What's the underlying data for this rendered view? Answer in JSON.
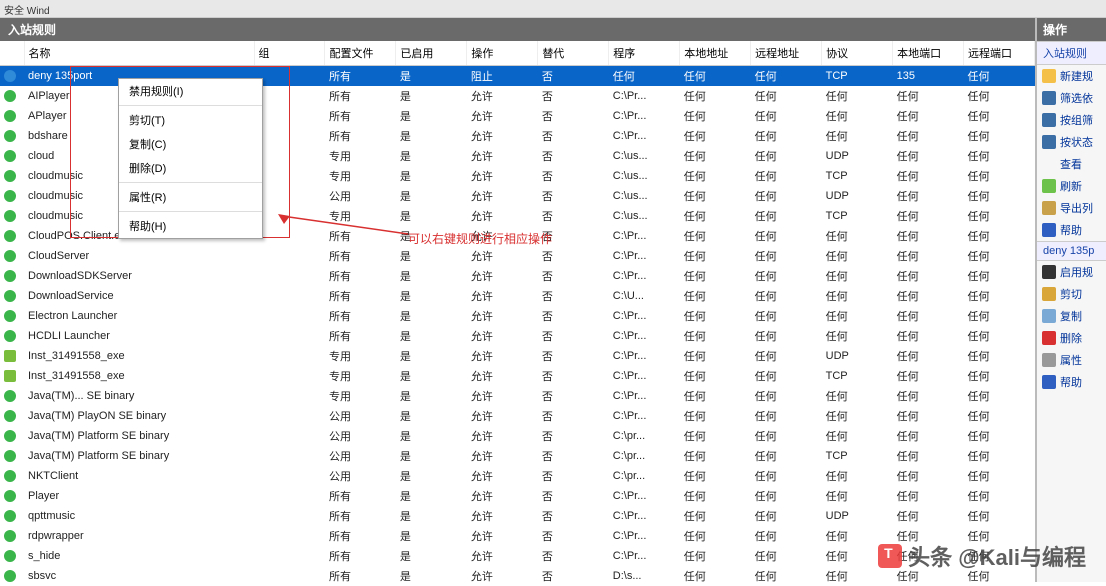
{
  "toolbar": {
    "title": "安全 Wind"
  },
  "section_title": "入站规则",
  "columns": [
    "名称",
    "组",
    "配置文件",
    "已启用",
    "操作",
    "替代",
    "程序",
    "本地地址",
    "远程地址",
    "协议",
    "本地端口",
    "远程端口"
  ],
  "context_menu": {
    "items": [
      "禁用规则(I)",
      "剪切(T)",
      "复制(C)",
      "删除(D)",
      "属性(R)",
      "帮助(H)"
    ]
  },
  "annotation": "可以右键规则进行相应操作",
  "watermark": "头条 @Kali与编程",
  "rows": [
    {
      "ic": "ic-blue",
      "name": "deny 135port",
      "grp": "",
      "prof": "所有",
      "en": "是",
      "act": "阻止",
      "repl": "否",
      "prog": "任何",
      "la": "任何",
      "ra": "任何",
      "proto": "TCP",
      "lp": "135",
      "rp": "任何",
      "sel": true
    },
    {
      "ic": "ic-green",
      "name": "AIPlayer",
      "grp": "",
      "prof": "所有",
      "en": "是",
      "act": "允许",
      "repl": "否",
      "prog": "C:\\Pr...",
      "la": "任何",
      "ra": "任何",
      "proto": "任何",
      "lp": "任何",
      "rp": "任何"
    },
    {
      "ic": "ic-green",
      "name": "APlayer",
      "grp": "",
      "prof": "所有",
      "en": "是",
      "act": "允许",
      "repl": "否",
      "prog": "C:\\Pr...",
      "la": "任何",
      "ra": "任何",
      "proto": "任何",
      "lp": "任何",
      "rp": "任何"
    },
    {
      "ic": "ic-green",
      "name": "bdshare",
      "grp": "",
      "prof": "所有",
      "en": "是",
      "act": "允许",
      "repl": "否",
      "prog": "C:\\Pr...",
      "la": "任何",
      "ra": "任何",
      "proto": "任何",
      "lp": "任何",
      "rp": "任何"
    },
    {
      "ic": "ic-green",
      "name": "cloud",
      "grp": "",
      "prof": "专用",
      "en": "是",
      "act": "允许",
      "repl": "否",
      "prog": "C:\\us...",
      "la": "任何",
      "ra": "任何",
      "proto": "UDP",
      "lp": "任何",
      "rp": "任何"
    },
    {
      "ic": "ic-green",
      "name": "cloudmusic",
      "grp": "",
      "prof": "专用",
      "en": "是",
      "act": "允许",
      "repl": "否",
      "prog": "C:\\us...",
      "la": "任何",
      "ra": "任何",
      "proto": "TCP",
      "lp": "任何",
      "rp": "任何"
    },
    {
      "ic": "ic-green",
      "name": "cloudmusic",
      "grp": "",
      "prof": "公用",
      "en": "是",
      "act": "允许",
      "repl": "否",
      "prog": "C:\\us...",
      "la": "任何",
      "ra": "任何",
      "proto": "UDP",
      "lp": "任何",
      "rp": "任何"
    },
    {
      "ic": "ic-green",
      "name": "cloudmusic",
      "grp": "",
      "prof": "专用",
      "en": "是",
      "act": "允许",
      "repl": "否",
      "prog": "C:\\us...",
      "la": "任何",
      "ra": "任何",
      "proto": "TCP",
      "lp": "任何",
      "rp": "任何"
    },
    {
      "ic": "ic-green",
      "name": "CloudPOS.Client.exe",
      "grp": "",
      "prof": "所有",
      "en": "是",
      "act": "允许",
      "repl": "否",
      "prog": "C:\\Pr...",
      "la": "任何",
      "ra": "任何",
      "proto": "任何",
      "lp": "任何",
      "rp": "任何"
    },
    {
      "ic": "ic-green",
      "name": "CloudServer",
      "grp": "",
      "prof": "所有",
      "en": "是",
      "act": "允许",
      "repl": "否",
      "prog": "C:\\Pr...",
      "la": "任何",
      "ra": "任何",
      "proto": "任何",
      "lp": "任何",
      "rp": "任何"
    },
    {
      "ic": "ic-green",
      "name": "DownloadSDKServer",
      "grp": "",
      "prof": "所有",
      "en": "是",
      "act": "允许",
      "repl": "否",
      "prog": "C:\\Pr...",
      "la": "任何",
      "ra": "任何",
      "proto": "任何",
      "lp": "任何",
      "rp": "任何"
    },
    {
      "ic": "ic-green",
      "name": "DownloadService",
      "grp": "",
      "prof": "所有",
      "en": "是",
      "act": "允许",
      "repl": "否",
      "prog": "C:\\U...",
      "la": "任何",
      "ra": "任何",
      "proto": "任何",
      "lp": "任何",
      "rp": "任何"
    },
    {
      "ic": "ic-green",
      "name": "Electron Launcher",
      "grp": "",
      "prof": "所有",
      "en": "是",
      "act": "允许",
      "repl": "否",
      "prog": "C:\\Pr...",
      "la": "任何",
      "ra": "任何",
      "proto": "任何",
      "lp": "任何",
      "rp": "任何"
    },
    {
      "ic": "ic-green",
      "name": "HCDLI Launcher",
      "grp": "",
      "prof": "所有",
      "en": "是",
      "act": "允许",
      "repl": "否",
      "prog": "C:\\Pr...",
      "la": "任何",
      "ra": "任何",
      "proto": "任何",
      "lp": "任何",
      "rp": "任何"
    },
    {
      "ic": "ic-green2",
      "name": "Inst_31491558_exe",
      "grp": "",
      "prof": "专用",
      "en": "是",
      "act": "允许",
      "repl": "否",
      "prog": "C:\\Pr...",
      "la": "任何",
      "ra": "任何",
      "proto": "UDP",
      "lp": "任何",
      "rp": "任何"
    },
    {
      "ic": "ic-green2",
      "name": "Inst_31491558_exe",
      "grp": "",
      "prof": "专用",
      "en": "是",
      "act": "允许",
      "repl": "否",
      "prog": "C:\\Pr...",
      "la": "任何",
      "ra": "任何",
      "proto": "TCP",
      "lp": "任何",
      "rp": "任何"
    },
    {
      "ic": "ic-green",
      "name": "Java(TM)... SE binary",
      "grp": "",
      "prof": "专用",
      "en": "是",
      "act": "允许",
      "repl": "否",
      "prog": "C:\\Pr...",
      "la": "任何",
      "ra": "任何",
      "proto": "任何",
      "lp": "任何",
      "rp": "任何"
    },
    {
      "ic": "ic-green",
      "name": "Java(TM) PlayON SE binary",
      "grp": "",
      "prof": "公用",
      "en": "是",
      "act": "允许",
      "repl": "否",
      "prog": "C:\\Pr...",
      "la": "任何",
      "ra": "任何",
      "proto": "任何",
      "lp": "任何",
      "rp": "任何"
    },
    {
      "ic": "ic-green",
      "name": "Java(TM) Platform SE binary",
      "grp": "",
      "prof": "公用",
      "en": "是",
      "act": "允许",
      "repl": "否",
      "prog": "C:\\pr...",
      "la": "任何",
      "ra": "任何",
      "proto": "任何",
      "lp": "任何",
      "rp": "任何"
    },
    {
      "ic": "ic-green",
      "name": "Java(TM) Platform SE binary",
      "grp": "",
      "prof": "公用",
      "en": "是",
      "act": "允许",
      "repl": "否",
      "prog": "C:\\pr...",
      "la": "任何",
      "ra": "任何",
      "proto": "TCP",
      "lp": "任何",
      "rp": "任何"
    },
    {
      "ic": "ic-green",
      "name": "NKTClient",
      "grp": "",
      "prof": "公用",
      "en": "是",
      "act": "允许",
      "repl": "否",
      "prog": "C:\\pr...",
      "la": "任何",
      "ra": "任何",
      "proto": "任何",
      "lp": "任何",
      "rp": "任何"
    },
    {
      "ic": "ic-green",
      "name": "Player",
      "grp": "",
      "prof": "所有",
      "en": "是",
      "act": "允许",
      "repl": "否",
      "prog": "C:\\Pr...",
      "la": "任何",
      "ra": "任何",
      "proto": "任何",
      "lp": "任何",
      "rp": "任何"
    },
    {
      "ic": "ic-green",
      "name": "qpttmusic",
      "grp": "",
      "prof": "所有",
      "en": "是",
      "act": "允许",
      "repl": "否",
      "prog": "C:\\Pr...",
      "la": "任何",
      "ra": "任何",
      "proto": "UDP",
      "lp": "任何",
      "rp": "任何"
    },
    {
      "ic": "ic-green",
      "name": "rdpwrapper",
      "grp": "",
      "prof": "所有",
      "en": "是",
      "act": "允许",
      "repl": "否",
      "prog": "C:\\Pr...",
      "la": "任何",
      "ra": "任何",
      "proto": "任何",
      "lp": "任何",
      "rp": "任何"
    },
    {
      "ic": "ic-green",
      "name": "s_hide",
      "grp": "",
      "prof": "所有",
      "en": "是",
      "act": "允许",
      "repl": "否",
      "prog": "C:\\Pr...",
      "la": "任何",
      "ra": "任何",
      "proto": "任何",
      "lp": "任何",
      "rp": "任何"
    },
    {
      "ic": "ic-green",
      "name": "sbsvc",
      "grp": "",
      "prof": "所有",
      "en": "是",
      "act": "允许",
      "repl": "否",
      "prog": "D:\\s...",
      "la": "任何",
      "ra": "任何",
      "proto": "任何",
      "lp": "任何",
      "rp": "任何"
    }
  ],
  "right": {
    "header": "操作",
    "section1": "入站规则",
    "items1": [
      {
        "ic": "#f5c048",
        "t": "新建规"
      },
      {
        "ic": "#3a6ea5",
        "t": "筛选依"
      },
      {
        "ic": "#3a6ea5",
        "t": "按组筛"
      },
      {
        "ic": "#3a6ea5",
        "t": "按状态"
      },
      {
        "ic": "",
        "t": "查看"
      },
      {
        "ic": "#6cc24a",
        "t": "刷新"
      },
      {
        "ic": "#c9a14a",
        "t": "导出列"
      },
      {
        "ic": "#2f5fc1",
        "t": "帮助"
      }
    ],
    "section2": "deny 135p",
    "items2": [
      {
        "ic": "#333",
        "t": "启用规"
      },
      {
        "ic": "#d9a63a",
        "t": "剪切"
      },
      {
        "ic": "#7aa9d6",
        "t": "复制"
      },
      {
        "ic": "#d83030",
        "t": "删除"
      },
      {
        "ic": "#999",
        "t": "属性"
      },
      {
        "ic": "#2f5fc1",
        "t": "帮助"
      }
    ]
  }
}
